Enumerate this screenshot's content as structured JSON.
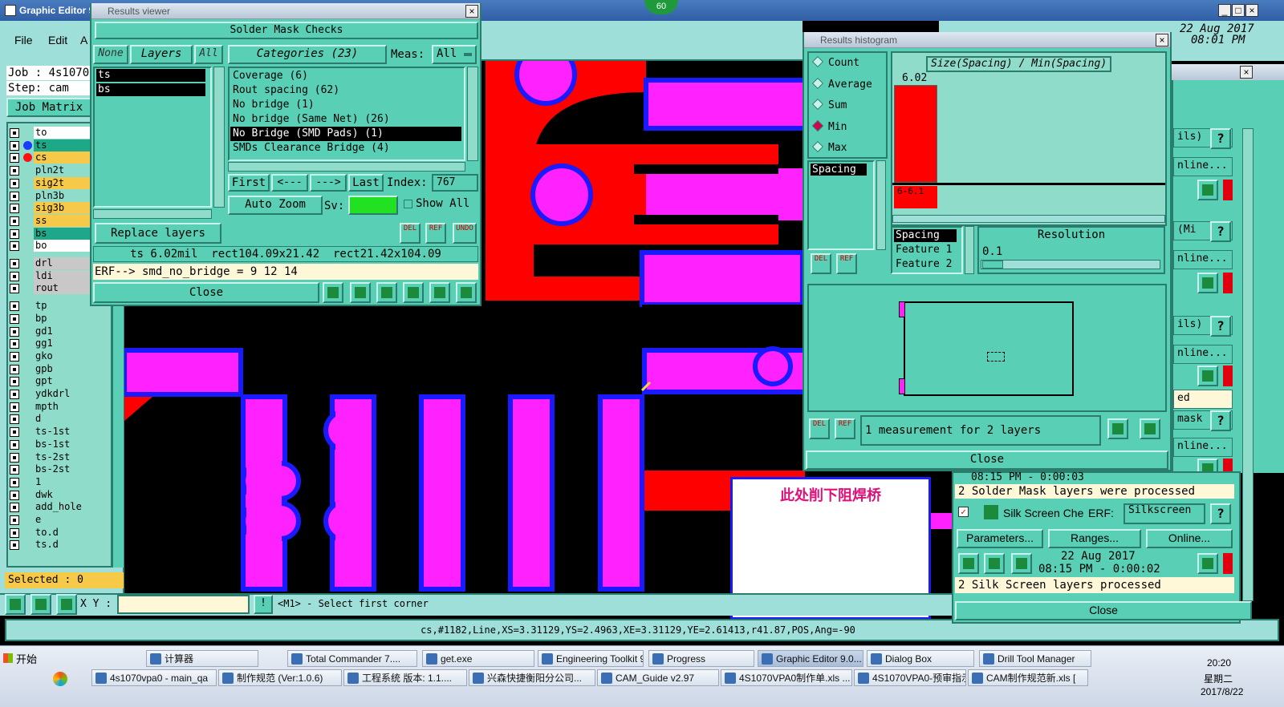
{
  "main_window": {
    "title": "Graphic Editor 9",
    "menu": [
      "File",
      "Edit",
      "A"
    ],
    "job_label": "Job : 4s1070",
    "step_label": "Step: cam",
    "job_matrix_btn": "Job Matrix",
    "selected_label": "Selected : 0",
    "xy_label": "X Y :",
    "status_prompt": "<M1> - Select first corner",
    "bottom_status": "cs,#1182,Line,XS=3.31129,YS=2.4963,XE=3.31129,YE=2.61413,r41.87,POS,Ang=-90",
    "clock_top": "22 Aug 2017",
    "clock_time": "08:01 PM",
    "badge": "60"
  },
  "layers": [
    "to",
    "ts",
    "cs",
    "pln2t",
    "sig2t",
    "pln3b",
    "sig3b",
    "ss",
    "bs",
    "bo",
    "drl",
    "ldi",
    "rout",
    "tp",
    "bp",
    "gd1",
    "gg1",
    "gko",
    "gpb",
    "gpt",
    "ydkdrl",
    "mpth",
    "d",
    "ts-1st",
    "bs-1st",
    "ts-2st",
    "bs-2st",
    "1",
    "dwk",
    "add_hole",
    "e",
    "to.d",
    "ts.d"
  ],
  "results_viewer": {
    "title": "Results viewer",
    "header": "Solder Mask Checks",
    "none_btn": "None",
    "layers_btn": "Layers",
    "all_btn": "All",
    "categories_btn": "Categories (23)",
    "meas_label": "Meas:",
    "meas_value": "All",
    "layer_list": [
      "ts",
      "bs"
    ],
    "categories": [
      "Coverage (6)",
      "Rout spacing (62)",
      "No bridge (1)",
      "No bridge (Same Net) (26)",
      "No Bridge (SMD Pads) (1)",
      "SMDs Clearance Bridge (4)"
    ],
    "first_btn": "First",
    "prev_btn": "<---",
    "next_btn": "--->",
    "last_btn": "Last",
    "index_label": "Index:",
    "index_value": "767",
    "auto_zoom": "Auto Zoom",
    "sv_label": "Sv:",
    "show_all": "Show All",
    "replace_layers": "Replace layers",
    "del_label": "DEL",
    "ref_label": "REF",
    "undo_label": "UNDO",
    "measure_line": "ts 6.02mil  rect104.09x21.42  rect21.42x104.09",
    "erf_line": "ERF--> smd_no_bridge = 9 12 14",
    "close_btn": "Close"
  },
  "histogram": {
    "title": "Results histogram",
    "modes": [
      "Count",
      "Average",
      "Sum",
      "Min",
      "Max"
    ],
    "selected_mode": "Min",
    "chart_title": "Size(Spacing) / Min(Spacing)",
    "bar_value": "6.02",
    "bar_range": "6-6.1",
    "list_item": "Spacing",
    "fields": [
      "Spacing",
      "Feature 1",
      "Feature 2"
    ],
    "resolution_label": "Resolution",
    "resolution_value": "0.1",
    "measurement_text": "1 measurement for 2 layers",
    "close_btn": "Close",
    "del_label": "DEL",
    "ref_label": "REF"
  },
  "annotation": {
    "text": "此处削下阻焊桥"
  },
  "right_panel": {
    "rows": [
      {
        "label": "ils)"
      },
      {
        "label": "nline..."
      },
      {
        "label": "(Mi"
      },
      {
        "label": "nline..."
      },
      {
        "label": "ils)"
      },
      {
        "label": "nline..."
      },
      {
        "label": "ed"
      },
      {
        "label": "mask"
      },
      {
        "label": "nline..."
      }
    ],
    "time_partial": "08:15 PM - 0:00:03",
    "solder_msg": "2 Solder Mask layers were processed",
    "silk_label": "Silk Screen Che",
    "erf_label": "ERF:",
    "silk_value": "Silkscreen",
    "params_btn": "Parameters...",
    "ranges_btn": "Ranges...",
    "online_btn": "Online...",
    "silk_date": "22 Aug 2017",
    "silk_time": "08:15 PM - 0:00:02",
    "silk_msg": "2 Silk Screen layers processed",
    "close_btn": "Close",
    "help": "?"
  },
  "taskbar": {
    "start": "开始",
    "row1": [
      "计算器",
      "Total Commander 7....",
      "get.exe",
      "Engineering Toolkit 9....",
      "Progress",
      "Graphic Editor 9.0...",
      "Dialog Box",
      "Drill Tool Manager"
    ],
    "row2": [
      "4s1070vpa0 - main_qa",
      "制作规范 (Ver:1.0.6)",
      "工程系统  版本: 1.1....",
      "兴森快捷衡阳分公司...",
      "CAM_Guide v2.97",
      "4S1070VPA0制作单.xls ...",
      "4S1070VPA0-预审指示....",
      "CAM制作规范新.xls ["
    ],
    "time": "20:20",
    "weekday": "星期二",
    "date": "2017/8/22"
  },
  "colors": {
    "teal": "#59d0b5",
    "cyan": "#9edfd9",
    "magenta": "#ff22ff",
    "red": "#ff0000",
    "blue": "#1a1aff"
  }
}
